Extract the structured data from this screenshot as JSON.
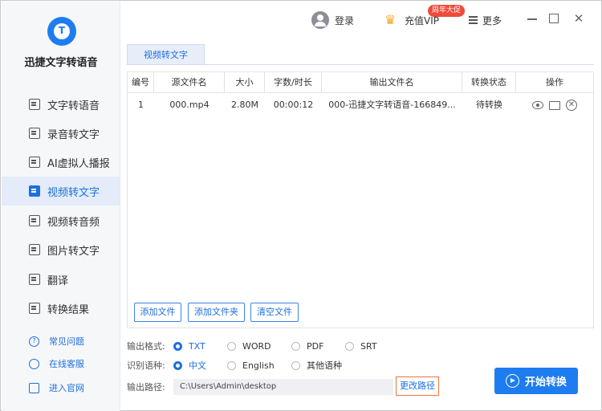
{
  "app": {
    "title": "迅捷文字转语音"
  },
  "sidebar": {
    "items": [
      {
        "label": "文字转语音",
        "icon": "text-to-speech-icon"
      },
      {
        "label": "录音转文字",
        "icon": "recording-icon"
      },
      {
        "label": "AI虚拟人播报",
        "icon": "ai-avatar-icon"
      },
      {
        "label": "视频转文字",
        "icon": "video-text-icon",
        "active": true
      },
      {
        "label": "视频转音频",
        "icon": "video-audio-icon"
      },
      {
        "label": "图片转文字",
        "icon": "image-text-icon"
      },
      {
        "label": "翻译",
        "icon": "translate-icon"
      },
      {
        "label": "转换结果",
        "icon": "results-icon"
      }
    ],
    "links": [
      {
        "label": "常见问题",
        "icon": "help-icon"
      },
      {
        "label": "在线客服",
        "icon": "headset-icon"
      },
      {
        "label": "进入官网",
        "icon": "monitor-icon"
      }
    ]
  },
  "topbar": {
    "login": "登录",
    "vip": "充值VIP",
    "vip_badge": "周年大促",
    "more": "更多"
  },
  "tab": {
    "label": "视频转文字"
  },
  "table": {
    "headers": [
      "编号",
      "源文件名",
      "大小",
      "字数/时长",
      "输出文件名",
      "转换状态",
      "操作"
    ],
    "rows": [
      {
        "no": "1",
        "source": "000.mp4",
        "size": "2.80M",
        "duration": "00:00:12",
        "output": "000-迅捷文字转语音-166849...",
        "status": "待转换"
      }
    ]
  },
  "buttons": {
    "add_file": "添加文件",
    "add_folder": "添加文件夹",
    "clear": "清空文件",
    "change_path": "更改路径",
    "start": "开始转换"
  },
  "settings": {
    "format_label": "输出格式:",
    "formats": [
      "TXT",
      "WORD",
      "PDF",
      "SRT"
    ],
    "selected_format": "TXT",
    "lang_label": "识别语种:",
    "languages": [
      "中文",
      "English",
      "其他语种"
    ],
    "selected_language": "中文",
    "path_label": "输出路径:",
    "path_value": "C:\\Users\\Admin\\desktop"
  },
  "colors": {
    "accent": "#1d7df0",
    "badge": "#f04a3a",
    "highlight_border": "#f0743c"
  }
}
